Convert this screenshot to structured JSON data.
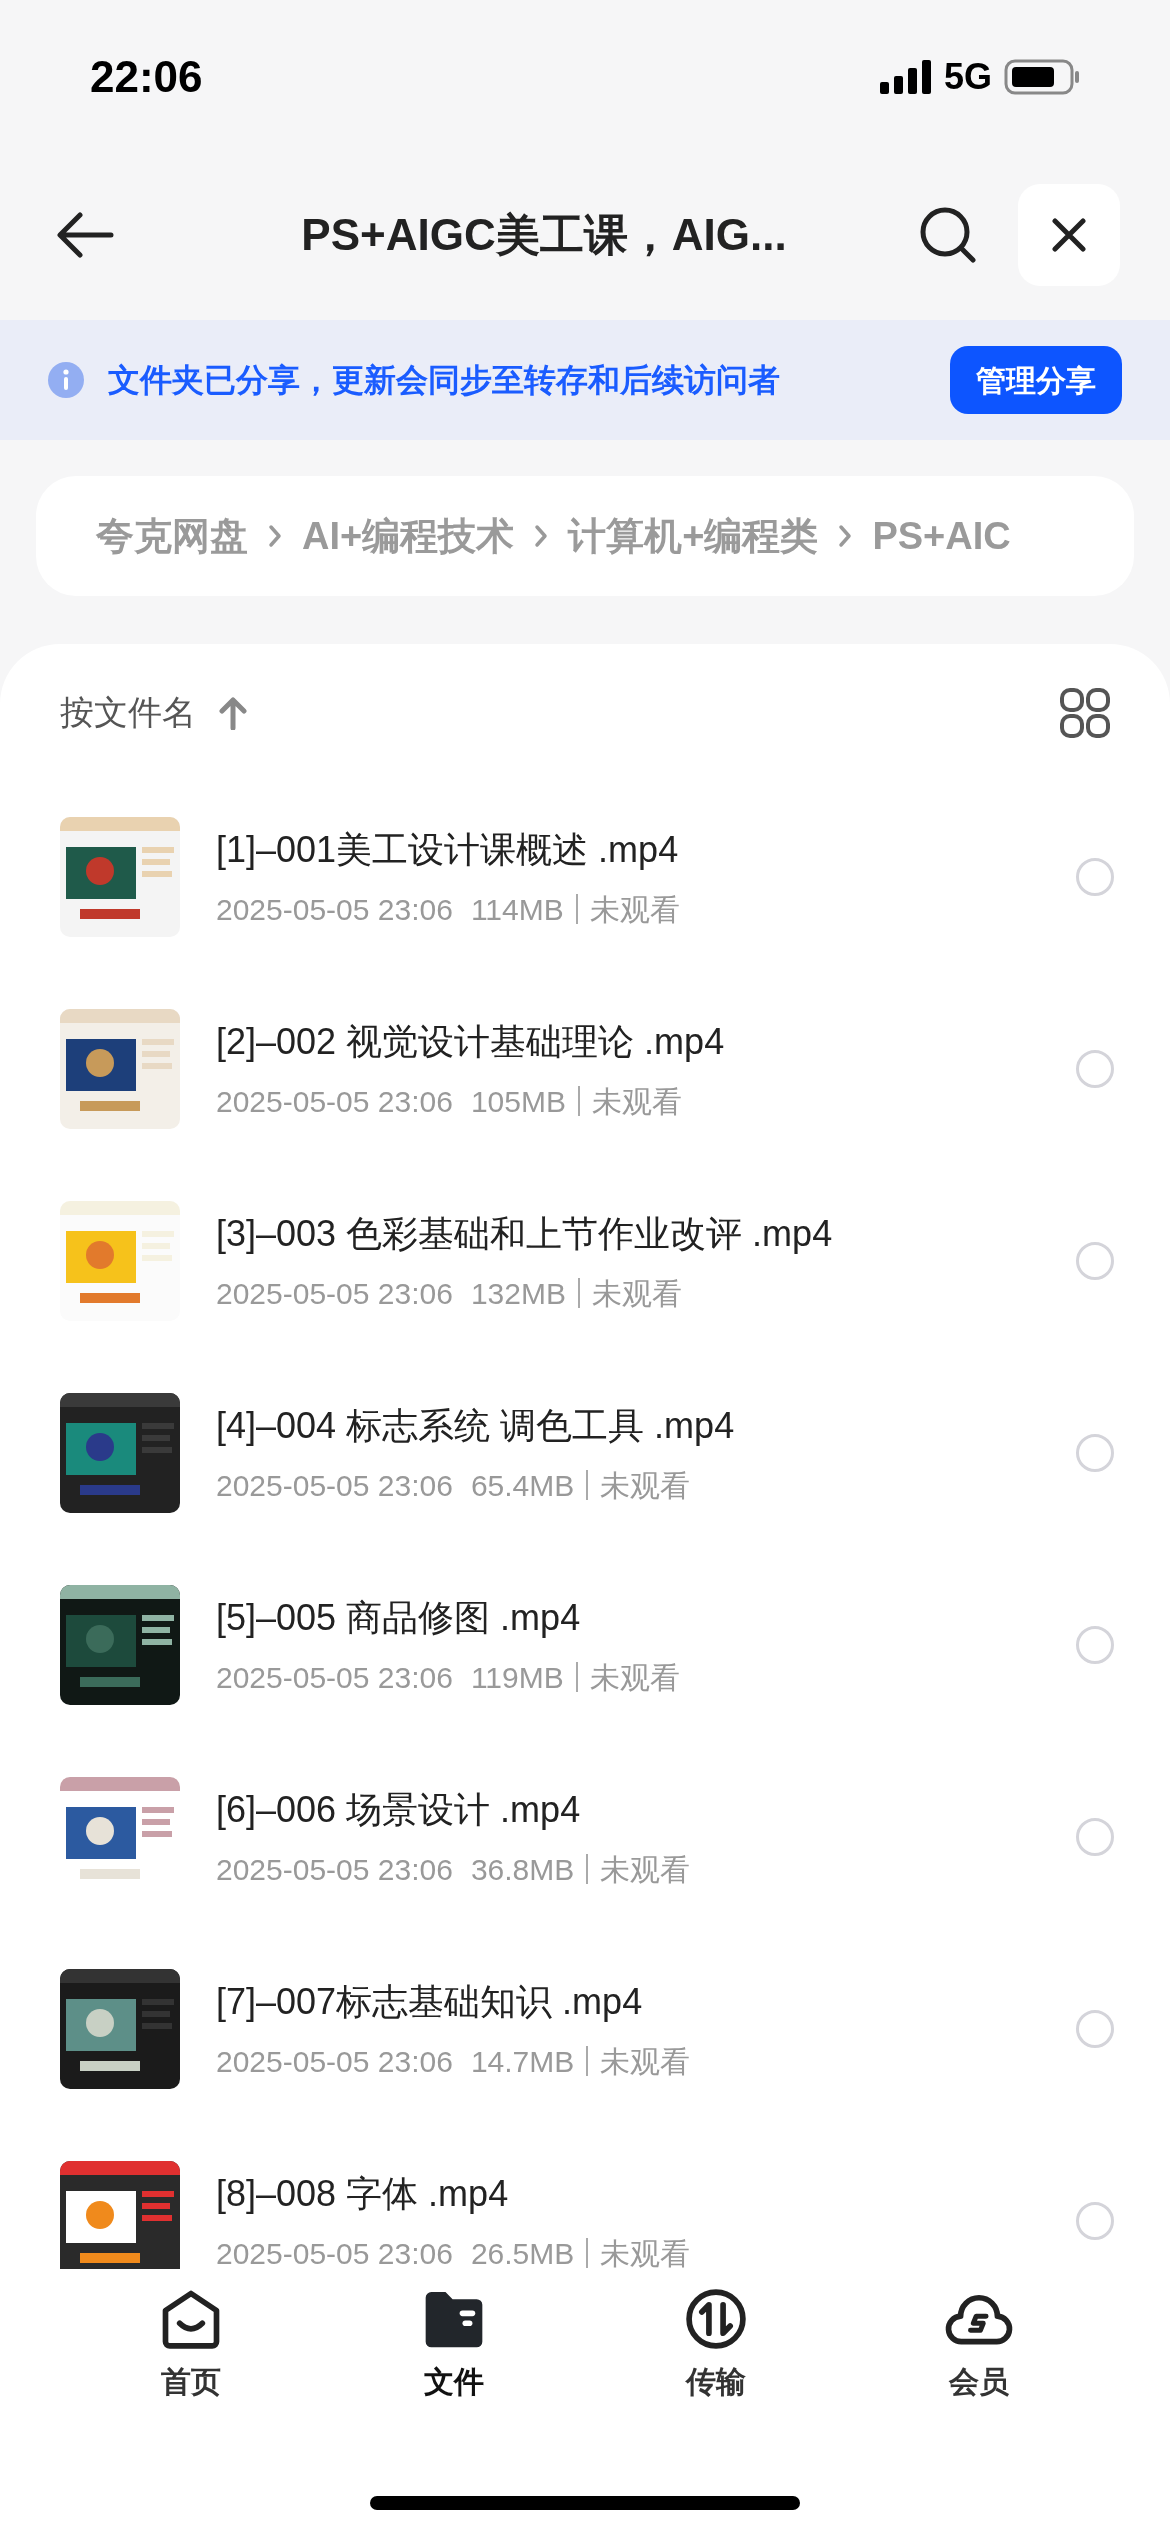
{
  "status_bar": {
    "time": "22:06",
    "network": "5G"
  },
  "header": {
    "title": "PS+AIGC美工课，AIG..."
  },
  "share_banner": {
    "message": "文件夹已分享，更新会同步至转存和后续访问者",
    "button": "管理分享"
  },
  "breadcrumb": [
    "夸克网盘",
    "AI+编程技术",
    "计算机+编程类",
    "PS+AIC"
  ],
  "sort": {
    "label": "按文件名"
  },
  "files": [
    {
      "name": "[1]–001美工设计课概述 .mp4",
      "date": "2025-05-05 23:06",
      "size": "114MB",
      "status": "未观看",
      "selected": false
    },
    {
      "name": "[2]–002 视觉设计基础理论 .mp4",
      "date": "2025-05-05 23:06",
      "size": "105MB",
      "status": "未观看",
      "selected": false
    },
    {
      "name": "[3]–003 色彩基础和上节作业改评 .mp4",
      "date": "2025-05-05 23:06",
      "size": "132MB",
      "status": "未观看",
      "selected": false
    },
    {
      "name": "[4]–004 标志系统 调色工具 .mp4",
      "date": "2025-05-05 23:06",
      "size": "65.4MB",
      "status": "未观看",
      "selected": false
    },
    {
      "name": "[5]–005 商品修图 .mp4",
      "date": "2025-05-05 23:06",
      "size": "119MB",
      "status": "未观看",
      "selected": false
    },
    {
      "name": "[6]–006 场景设计 .mp4",
      "date": "2025-05-05 23:06",
      "size": "36.8MB",
      "status": "未观看",
      "selected": false
    },
    {
      "name": "[7]–007标志基础知识 .mp4",
      "date": "2025-05-05 23:06",
      "size": "14.7MB",
      "status": "未观看",
      "selected": false
    },
    {
      "name": "[8]–008 字体 .mp4",
      "date": "2025-05-05 23:06",
      "size": "26.5MB",
      "status": "未观看",
      "selected": false
    }
  ],
  "tab_bar": [
    {
      "label": "首页",
      "selected": false
    },
    {
      "label": "文件",
      "selected": true
    },
    {
      "label": "传输",
      "selected": false
    },
    {
      "label": "会员",
      "selected": false
    }
  ]
}
